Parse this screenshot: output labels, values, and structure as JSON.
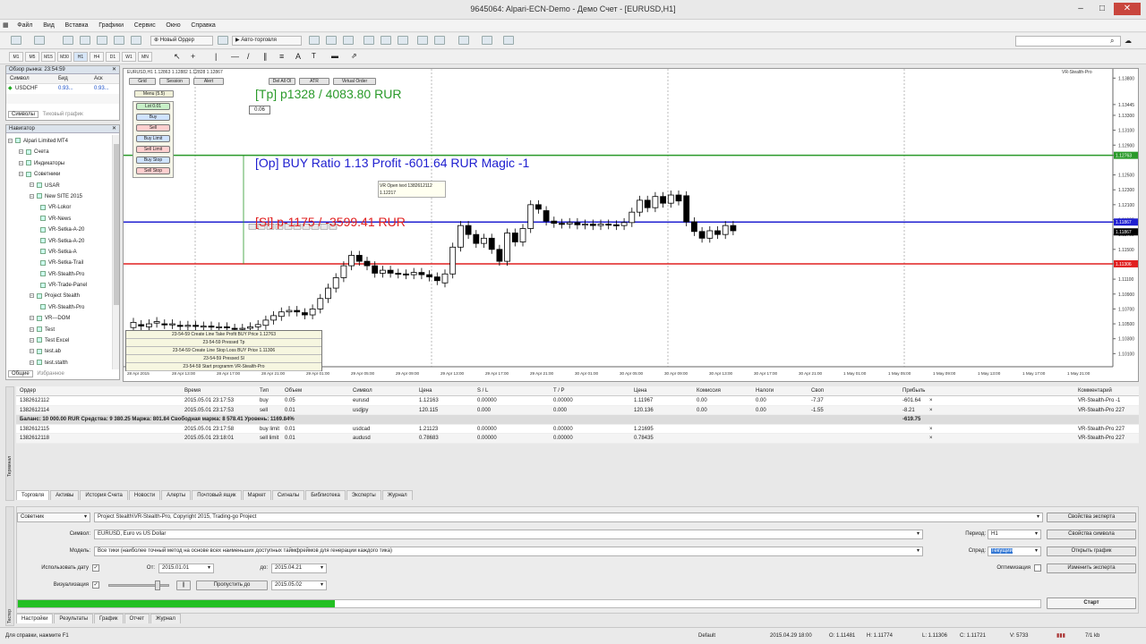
{
  "window": {
    "title": "9645064: Alpari-ECN-Demo - Демо Счет - [EURUSD,H1]"
  },
  "menu": [
    "Файл",
    "Вид",
    "Вставка",
    "Графики",
    "Сервис",
    "Окно",
    "Справка"
  ],
  "toolbar": {
    "new_order": "Новый Ордер",
    "autotrade": "Авто-торговля"
  },
  "timeframes": [
    "M1",
    "M5",
    "M15",
    "M30",
    "H1",
    "H4",
    "D1",
    "W1",
    "MN"
  ],
  "market_watch": {
    "title": "Обзор рынка: 23:54:59",
    "headers": [
      "Символ",
      "Бид",
      "Аск"
    ],
    "rows": [
      {
        "symbol": "USDCHF",
        "bid": "0.93...",
        "ask": "0.93..."
      },
      {
        "symbol": "",
        "bid": "",
        "ask": ""
      }
    ],
    "tabs": [
      "Символы",
      "Тиковый график"
    ]
  },
  "navigator": {
    "title": "Навигатор",
    "items": [
      {
        "label": "Alpari Limited MT4",
        "level": 0
      },
      {
        "label": "Счета",
        "level": 1
      },
      {
        "label": "Индикаторы",
        "level": 1
      },
      {
        "label": "Советники",
        "level": 1
      },
      {
        "label": "USAR",
        "level": 2
      },
      {
        "label": "New SITE 2015",
        "level": 2
      },
      {
        "label": "VR-Lokor",
        "level": 3
      },
      {
        "label": "VR-News",
        "level": 3
      },
      {
        "label": "VR-Setka-A-20",
        "level": 3
      },
      {
        "label": "VR-Setka-A-20",
        "level": 3
      },
      {
        "label": "VR-Setka-A",
        "level": 3
      },
      {
        "label": "VR-Setka-Trail",
        "level": 3
      },
      {
        "label": "VR-Stealth-Pro",
        "level": 3
      },
      {
        "label": "VR-Trade-Panel",
        "level": 3
      },
      {
        "label": "Project Stealth",
        "level": 2
      },
      {
        "label": "VR-Stealth-Pro",
        "level": 3
      },
      {
        "label": "VR---DOM",
        "level": 2
      },
      {
        "label": "Test",
        "level": 2
      },
      {
        "label": "Test Excel",
        "level": 2
      },
      {
        "label": "test.ab",
        "level": 2
      },
      {
        "label": "test.stalth",
        "level": 2
      }
    ],
    "tabs": [
      "Общие",
      "Избранное"
    ]
  },
  "chart": {
    "header": "EURUSD,H1  1.12863 1.12882 1.12828 1.12867",
    "indicator": "VR-Stealth-Pro",
    "top_buttons": [
      "Grid",
      "Session",
      "Alert"
    ],
    "top_buttons2": [
      "Del All Ol",
      "ATR",
      "Virtual Order"
    ],
    "menu_label": "Menu (5.5)",
    "lot_value": "0.06",
    "side_buttons": [
      "Lot 0.01",
      "Buy",
      "Sell",
      "Buy Limit",
      "Sell Limit",
      "Buy Stop",
      "Sell Stop"
    ],
    "tp_label": "[Tp]  p1328 / 4083.80 RUR",
    "op_label": "[Op] BUY  Ratio 1.13  Profit -601.64 RUR  Magic -1",
    "sl_label": "[Sl]  p-1175 / -3599.41 RUR",
    "tooltip_line1": "VR Open text 1382612112",
    "tooltip_line2": "1.12217",
    "log": [
      "23-54-59 Create Line Take Profit BUY Price 1.12763",
      "23-54-59 Pressed Tp",
      "23-54-59 Create Line Stop Loss BUY Price 1.11306",
      "23-54-59 Pressed Sl",
      "23-54-59 Start programm VR-Stealth-Pro"
    ],
    "price_ticks": [
      "1.13800",
      "1.13445",
      "1.13300",
      "1.13100",
      "1.12900",
      "1.12763",
      "1.12500",
      "1.12300",
      "1.12100",
      "1.11900",
      "1.11867",
      "1.11700",
      "1.11500",
      "1.11306",
      "1.11100",
      "1.10900",
      "1.10700",
      "1.10500",
      "1.10300",
      "1.10100",
      "1.09900"
    ],
    "time_ticks": [
      "28 Apr 2015",
      "28 Apr 13:00",
      "28 Apr 17:00",
      "28 Apr 21:00",
      "29 Apr 01:00",
      "29 Apr 05:00",
      "29 Apr 09:00",
      "29 Apr 13:00",
      "29 Apr 17:00",
      "29 Apr 21:00",
      "30 Apr 01:00",
      "30 Apr 05:00",
      "30 Apr 09:00",
      "30 Apr 13:00",
      "30 Apr 17:00",
      "30 Apr 21:00",
      "1 May 01:00",
      "1 May 05:00",
      "1 May 09:00",
      "1 May 13:00",
      "1 May 17:00",
      "1 May 21:00"
    ],
    "tick_values": {
      "tp": 1.12763,
      "op": 1.11867,
      "sl": 1.11306,
      "cur": 1.11867
    },
    "candles": [
      [
        1.1045,
        1.1052
      ],
      [
        1.1049,
        1.1047
      ],
      [
        1.1046,
        1.105
      ],
      [
        1.1051,
        1.1053
      ],
      [
        1.105,
        1.1049
      ],
      [
        1.1049,
        1.105
      ],
      [
        1.1048,
        1.1047
      ],
      [
        1.1047,
        1.1048
      ],
      [
        1.1048,
        1.1047
      ],
      [
        1.1046,
        1.1047
      ],
      [
        1.1047,
        1.1046
      ],
      [
        1.1045,
        1.1046
      ],
      [
        1.1046,
        1.1045
      ],
      [
        1.1044,
        1.1043
      ],
      [
        1.1043,
        1.1044
      ],
      [
        1.1044,
        1.1046
      ],
      [
        1.1046,
        1.1049
      ],
      [
        1.1048,
        1.1055
      ],
      [
        1.1055,
        1.1061
      ],
      [
        1.106,
        1.1066
      ],
      [
        1.1066,
        1.1068
      ],
      [
        1.1068,
        1.1066
      ],
      [
        1.1065,
        1.1062
      ],
      [
        1.1062,
        1.107
      ],
      [
        1.107,
        1.1084
      ],
      [
        1.1084,
        1.1098
      ],
      [
        1.1098,
        1.1112
      ],
      [
        1.1112,
        1.1128
      ],
      [
        1.1128,
        1.1142
      ],
      [
        1.1142,
        1.1134
      ],
      [
        1.1134,
        1.1128
      ],
      [
        1.1128,
        1.1118
      ],
      [
        1.1118,
        1.1122
      ],
      [
        1.1122,
        1.1118
      ],
      [
        1.1118,
        1.1117
      ],
      [
        1.1117,
        1.1116
      ],
      [
        1.1116,
        1.1119
      ],
      [
        1.1119,
        1.1116
      ],
      [
        1.1116,
        1.1113
      ],
      [
        1.1113,
        1.1108
      ],
      [
        1.1105,
        1.1117
      ],
      [
        1.1117,
        1.1153
      ],
      [
        1.1153,
        1.1182
      ],
      [
        1.1182,
        1.117
      ],
      [
        1.117,
        1.1158
      ],
      [
        1.1158,
        1.1165
      ],
      [
        1.1165,
        1.115
      ],
      [
        1.115,
        1.1134
      ],
      [
        1.1134,
        1.1172
      ],
      [
        1.1172,
        1.116
      ],
      [
        1.116,
        1.1178
      ],
      [
        1.1178,
        1.121
      ],
      [
        1.121,
        1.1204
      ],
      [
        1.1202,
        1.1188
      ],
      [
        1.1188,
        1.1185
      ],
      [
        1.1185,
        1.1184
      ],
      [
        1.1184,
        1.1186
      ],
      [
        1.1186,
        1.1183
      ],
      [
        1.1183,
        1.1184
      ],
      [
        1.1184,
        1.1182
      ],
      [
        1.1182,
        1.1184
      ],
      [
        1.1184,
        1.1183
      ],
      [
        1.1183,
        1.1182
      ],
      [
        1.1182,
        1.1186
      ],
      [
        1.1186,
        1.12
      ],
      [
        1.12,
        1.1216
      ],
      [
        1.1216,
        1.1206
      ],
      [
        1.1206,
        1.1221
      ],
      [
        1.1221,
        1.1212
      ],
      [
        1.1212,
        1.1223
      ],
      [
        1.1223,
        1.1215
      ],
      [
        1.1222,
        1.1187
      ],
      [
        1.1187,
        1.1174
      ],
      [
        1.1174,
        1.1165
      ],
      [
        1.1165,
        1.1175
      ],
      [
        1.1175,
        1.117
      ],
      [
        1.117,
        1.1182
      ],
      [
        1.1182,
        1.1175
      ]
    ],
    "y_range": [
      1.099,
      1.139
    ]
  },
  "orders": {
    "headers": [
      "Ордер",
      "Время",
      "Тип",
      "Объем",
      "Символ",
      "Цена",
      "S / L",
      "T / P",
      "Цена",
      "Комиссия",
      "Налоги",
      "Своп",
      "Прибыль",
      "Комментарий"
    ],
    "rows": [
      [
        "1382612112",
        "2015.05.01 23:17:53",
        "buy",
        "0.05",
        "eurusd",
        "1.12163",
        "0.00000",
        "0.00000",
        "1.11967",
        "0.00",
        "0.00",
        "-7.37",
        "-601.64",
        "VR-Stealth-Pro -1"
      ],
      [
        "1382612114",
        "2015.05.01 23:17:53",
        "sell",
        "0.01",
        "usdjpy",
        "120.115",
        "0.000",
        "0.000",
        "120.136",
        "0.00",
        "0.00",
        "-1.55",
        "-8.21",
        "VR-Stealth-Pro 227"
      ]
    ],
    "balance": "Баланс: 10 000.00 RUR  Средства: 9 380.25  Маржа: 801.84  Свободная маржа: 8 578.41  Уровень: 1169.84%",
    "balance_profit": "-619.75",
    "pending": [
      [
        "1382612115",
        "2015.05.01 23:17:58",
        "buy limit",
        "0.01",
        "usdcad",
        "1.21123",
        "0.00000",
        "0.00000",
        "1.21695",
        "",
        "",
        "",
        "",
        "VR-Stealth-Pro 227"
      ],
      [
        "1382612118",
        "2015.05.01 23:18:01",
        "sell limit",
        "0.01",
        "audusd",
        "0.78683",
        "0.00000",
        "0.00000",
        "0.78435",
        "",
        "",
        "",
        "",
        "VR-Stealth-Pro 227"
      ]
    ]
  },
  "terminal_tabs": [
    "Торговля",
    "Активы",
    "История Счета",
    "Новости",
    "Алерты",
    "Почтовый ящик",
    "Маркет",
    "Сигналы",
    "Библиотека",
    "Эксперты",
    "Журнал"
  ],
  "tester": {
    "expert_type": "Советник",
    "expert_value": "Project Stealth\\VR-Stealth-Pro, Copyright 2015, Trading-go Project",
    "expert_props": "Свойства эксперта",
    "symbol_label": "Символ:",
    "symbol_value": "EURUSD, Euro vs US Dollar",
    "symbol_props": "Свойства символа",
    "model_label": "Модель:",
    "model_value": "Все тики (наиболее точный метод на основе всех наименьших доступных таймфреймов для генерации каждого тика)",
    "period_label": "Период:",
    "period_value": "H1",
    "open_chart": "Открыть график",
    "spread_label": "Спред:",
    "spread_value": "Текущий",
    "use_date_label": "Использовать дату",
    "from_label": "От:",
    "from_value": "2015.01.01",
    "to_label": "до:",
    "to_value": "2015.04.21",
    "optim_label": "Оптимизация",
    "change_expert": "Изменить эксперта",
    "visual_label": "Визуализация",
    "skip_to": "Пропустить до",
    "skip_value": "2015.05.02",
    "progress": 0.31,
    "start": "Старт",
    "tabs": [
      "Настройки",
      "Результаты",
      "График",
      "Отчет",
      "Журнал"
    ],
    "side_label": "Тестер",
    "side_label2": "Терминал"
  },
  "status": {
    "help": "Для справки, нажмите F1",
    "profile": "Default",
    "time": "2015.04.29 18:00",
    "o": "O: 1.11481",
    "h": "H: 1.11774",
    "l": "L: 1.11306",
    "c": "C: 1.11721",
    "v": "V: 5733",
    "traffic": "7/1 kb"
  },
  "colors": {
    "tp": "#2a9a2a",
    "op": "#2020d0",
    "sl": "#e02020",
    "progress": "#22c022"
  }
}
